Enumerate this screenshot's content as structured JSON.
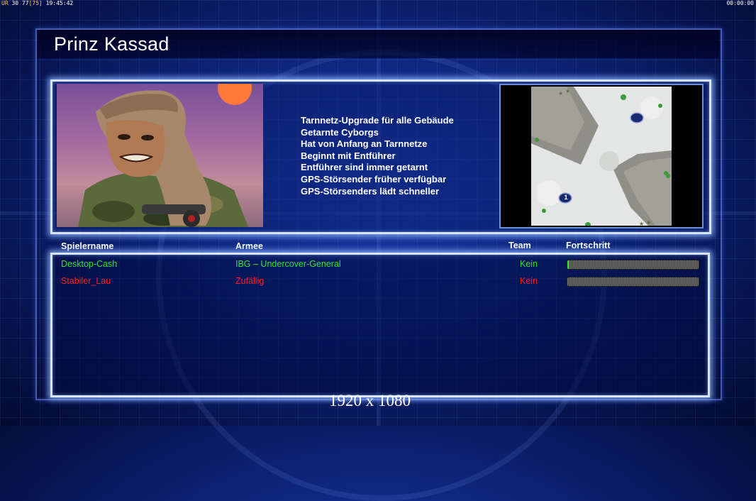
{
  "hud": {
    "ur_label": "UR",
    "ur_value": "30",
    "fps_value": "77",
    "fps_bracket": "[75]",
    "clock": "19:45:42",
    "timer": "00:00:00"
  },
  "title": "Prinz Kassad",
  "features": [
    "Tarnnetz-Upgrade für alle Gebäude",
    "Getarnte Cyborgs",
    "Hat von Anfang an Tarnnetze",
    "Beginnt mit Entführer",
    "Entführer sind immer getarnt",
    "GPS-Störsender früher verfügbar",
    "GPS-Störsenders lädt schneller"
  ],
  "map": {
    "start_marker_1": "1"
  },
  "table": {
    "headers": {
      "player": "Spielername",
      "army": "Armee",
      "team": "Team",
      "progress": "Fortschritt"
    },
    "rows": [
      {
        "player": "Desktop-Cash",
        "army": "IBG – Undercover-General",
        "team": "Kein",
        "color": "#35e035",
        "progress": 0.01
      },
      {
        "player": "Stabiler_Lau",
        "army": "Zufällig",
        "team": "Kein",
        "color": "#ff2020",
        "progress": 0.0
      }
    ]
  },
  "resolution": "1920 x 1080",
  "colors": {
    "accent_glow": "#d8e4ff",
    "background": "#0d2478",
    "player1": "#35e035",
    "player2": "#ff2020"
  }
}
